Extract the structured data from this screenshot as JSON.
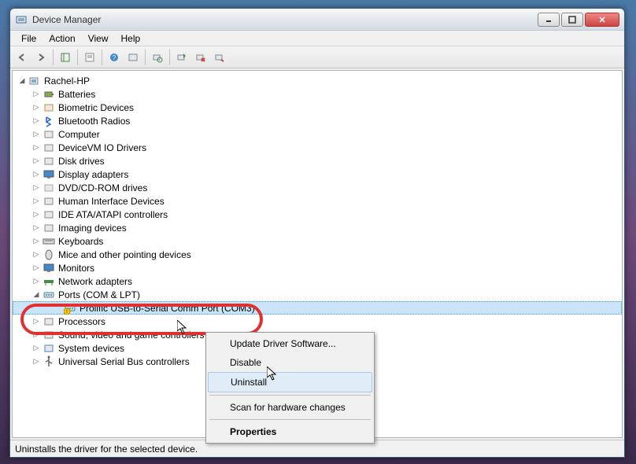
{
  "window": {
    "title": "Device Manager"
  },
  "menubar": {
    "items": [
      "File",
      "Action",
      "View",
      "Help"
    ]
  },
  "tree": {
    "root": "Rachel-HP",
    "categories": [
      {
        "label": "Batteries",
        "icon": "battery"
      },
      {
        "label": "Biometric Devices",
        "icon": "biometric"
      },
      {
        "label": "Bluetooth Radios",
        "icon": "bluetooth"
      },
      {
        "label": "Computer",
        "icon": "computer"
      },
      {
        "label": "DeviceVM IO Drivers",
        "icon": "driver"
      },
      {
        "label": "Disk drives",
        "icon": "disk"
      },
      {
        "label": "Display adapters",
        "icon": "display"
      },
      {
        "label": "DVD/CD-ROM drives",
        "icon": "dvd"
      },
      {
        "label": "Human Interface Devices",
        "icon": "hid"
      },
      {
        "label": "IDE ATA/ATAPI controllers",
        "icon": "ide"
      },
      {
        "label": "Imaging devices",
        "icon": "imaging"
      },
      {
        "label": "Keyboards",
        "icon": "keyboard"
      },
      {
        "label": "Mice and other pointing devices",
        "icon": "mouse"
      },
      {
        "label": "Monitors",
        "icon": "monitor"
      },
      {
        "label": "Network adapters",
        "icon": "network"
      },
      {
        "label": "Ports (COM & LPT)",
        "icon": "port",
        "expanded": true,
        "children": [
          {
            "label": "Prolific USB-to-Serial Comm Port (COM3)",
            "icon": "port",
            "warning": true,
            "selected": true
          }
        ]
      },
      {
        "label": "Processors",
        "icon": "cpu"
      },
      {
        "label": "Sound, video and game controllers",
        "icon": "sound"
      },
      {
        "label": "System devices",
        "icon": "system"
      },
      {
        "label": "Universal Serial Bus controllers",
        "icon": "usb"
      }
    ]
  },
  "context_menu": {
    "items": [
      {
        "label": "Update Driver Software...",
        "type": "item"
      },
      {
        "label": "Disable",
        "type": "item"
      },
      {
        "label": "Uninstall",
        "type": "item",
        "highlight": true
      },
      {
        "type": "sep"
      },
      {
        "label": "Scan for hardware changes",
        "type": "item"
      },
      {
        "type": "sep"
      },
      {
        "label": "Properties",
        "type": "item",
        "bold": true
      }
    ]
  },
  "statusbar": {
    "text": "Uninstalls the driver for the selected device."
  }
}
